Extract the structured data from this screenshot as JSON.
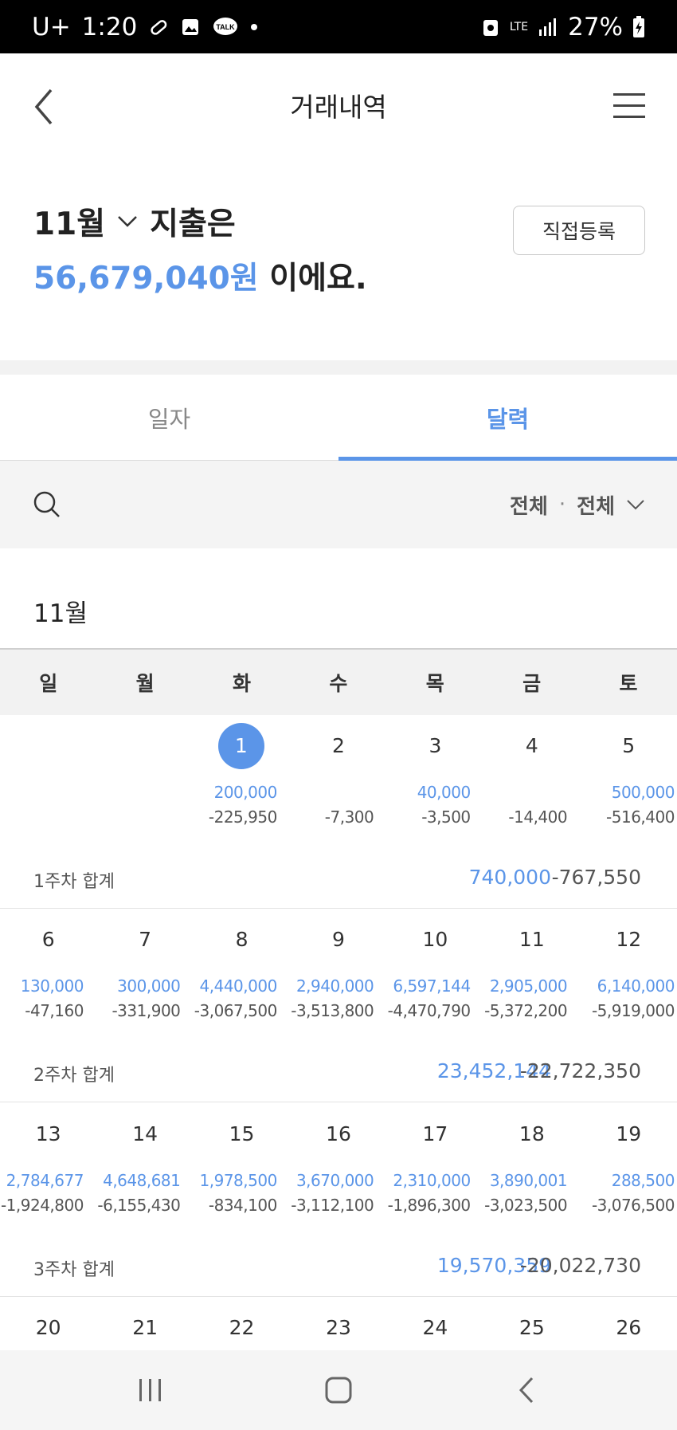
{
  "status_bar": {
    "carrier": "U+",
    "time": "1:20",
    "battery": "27%",
    "network": "LTE"
  },
  "header": {
    "title": "거래내역"
  },
  "summary": {
    "month": "11월",
    "spend_label": "지출은",
    "amount": "56,679,040원",
    "suffix": "이에요.",
    "register_button": "직접등록"
  },
  "tabs": [
    {
      "label": "일자",
      "active": false
    },
    {
      "label": "달력",
      "active": true
    }
  ],
  "filter": {
    "scope": "전체",
    "separator": "·",
    "type": "전체"
  },
  "calendar": {
    "month_title": "11월",
    "weekdays": [
      "일",
      "월",
      "화",
      "수",
      "목",
      "금",
      "토"
    ],
    "weeks": [
      {
        "days": [
          null,
          null,
          {
            "d": "1",
            "inc": "200,000",
            "exp": "-225,950",
            "selected": true
          },
          {
            "d": "2",
            "inc": "",
            "exp": "-7,300"
          },
          {
            "d": "3",
            "inc": "40,000",
            "exp": "-3,500"
          },
          {
            "d": "4",
            "inc": "",
            "exp": "-14,400"
          },
          {
            "d": "5",
            "inc": "500,000",
            "exp": "-516,400"
          }
        ],
        "sum_label": "1주차 합계",
        "sum_inc": "740,000",
        "sum_exp": "-767,550"
      },
      {
        "days": [
          {
            "d": "6",
            "inc": "130,000",
            "exp": "-47,160"
          },
          {
            "d": "7",
            "inc": "300,000",
            "exp": "-331,900"
          },
          {
            "d": "8",
            "inc": "4,440,000",
            "exp": "-3,067,500"
          },
          {
            "d": "9",
            "inc": "2,940,000",
            "exp": "-3,513,800"
          },
          {
            "d": "10",
            "inc": "6,597,144",
            "exp": "-4,470,790"
          },
          {
            "d": "11",
            "inc": "2,905,000",
            "exp": "-5,372,200"
          },
          {
            "d": "12",
            "inc": "6,140,000",
            "exp": "-5,919,000"
          }
        ],
        "sum_label": "2주차 합계",
        "sum_inc": "23,452,144",
        "sum_exp": "-22,722,350"
      },
      {
        "days": [
          {
            "d": "13",
            "inc": "2,784,677",
            "exp": "-1,924,800"
          },
          {
            "d": "14",
            "inc": "4,648,681",
            "exp": "-6,155,430"
          },
          {
            "d": "15",
            "inc": "1,978,500",
            "exp": "-834,100"
          },
          {
            "d": "16",
            "inc": "3,670,000",
            "exp": "-3,112,100"
          },
          {
            "d": "17",
            "inc": "2,310,000",
            "exp": "-1,896,300"
          },
          {
            "d": "18",
            "inc": "3,890,001",
            "exp": "-3,023,500"
          },
          {
            "d": "19",
            "inc": "288,500",
            "exp": "-3,076,500"
          }
        ],
        "sum_label": "3주차 합계",
        "sum_inc": "19,570,359",
        "sum_exp": "-20,022,730"
      },
      {
        "days": [
          {
            "d": "20",
            "inc": "",
            "exp": ""
          },
          {
            "d": "21",
            "inc": "",
            "exp": ""
          },
          {
            "d": "22",
            "inc": "",
            "exp": ""
          },
          {
            "d": "23",
            "inc": "",
            "exp": ""
          },
          {
            "d": "24",
            "inc": "",
            "exp": ""
          },
          {
            "d": "25",
            "inc": "",
            "exp": ""
          },
          {
            "d": "26",
            "inc": "",
            "exp": ""
          }
        ]
      }
    ]
  },
  "colors": {
    "accent": "#5b95e8",
    "text": "#333333",
    "band": "#f2f2f2"
  }
}
